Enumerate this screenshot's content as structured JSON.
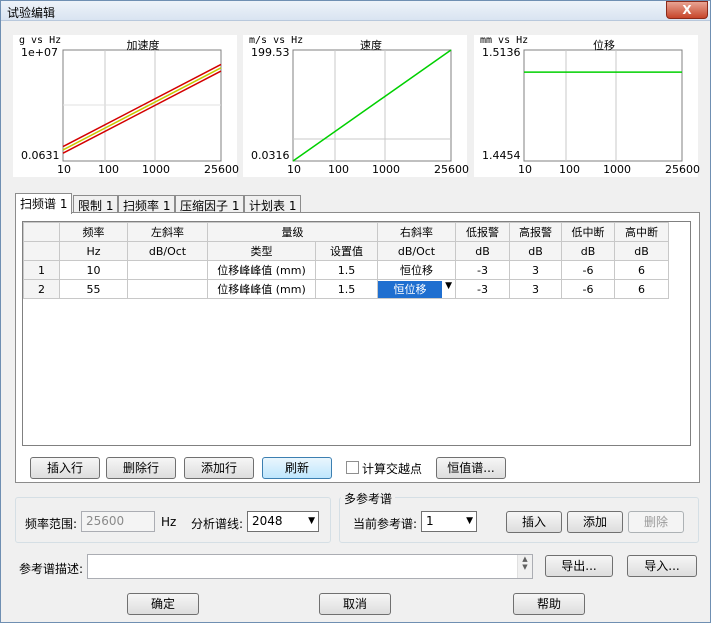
{
  "window": {
    "title": "试验编辑",
    "close_label": "X"
  },
  "charts": [
    {
      "title": "加速度",
      "unit": "g  vs  Hz",
      "y_top": "1e+07",
      "y_bottom": "0.0631",
      "x_ticks": [
        "10",
        "100",
        "1000",
        "25600"
      ]
    },
    {
      "title": "速度",
      "unit": "m/s  vs  Hz",
      "y_top": "199.53",
      "y_bottom": "0.0316",
      "x_ticks": [
        "10",
        "100",
        "1000",
        "25600"
      ]
    },
    {
      "title": "位移",
      "unit": "mm  vs  Hz",
      "y_top": "1.5136",
      "y_bottom": "1.4454",
      "x_ticks": [
        "10",
        "100",
        "1000",
        "25600"
      ]
    }
  ],
  "chart_data": [
    {
      "type": "line",
      "title": "加速度",
      "xlabel": "Hz",
      "ylabel": "g",
      "x_scale": "log",
      "y_scale": "log",
      "xlim": [
        10,
        25600
      ],
      "ylim": [
        0.0631,
        10000000
      ],
      "grid": true,
      "series": [
        {
          "color": "#d40000",
          "x": [
            10,
            25600
          ],
          "y_frac": [
            0.13,
            0.87
          ]
        },
        {
          "color": "#c8c800",
          "x": [
            10,
            25600
          ],
          "y_frac": [
            0.1,
            0.84
          ]
        },
        {
          "color": "#d40000",
          "x": [
            10,
            25600
          ],
          "y_frac": [
            0.07,
            0.81
          ]
        }
      ]
    },
    {
      "type": "line",
      "title": "速度",
      "xlabel": "Hz",
      "ylabel": "m/s",
      "x_scale": "log",
      "y_scale": "log",
      "xlim": [
        10,
        25600
      ],
      "ylim": [
        0.0316,
        199.53
      ],
      "grid": true,
      "series": [
        {
          "color": "#00d000",
          "x": [
            10,
            25600
          ],
          "y": [
            0.0316,
            199.53
          ]
        }
      ]
    },
    {
      "type": "line",
      "title": "位移",
      "xlabel": "Hz",
      "ylabel": "mm",
      "x_scale": "log",
      "xlim": [
        10,
        25600
      ],
      "ylim": [
        1.4454,
        1.5136
      ],
      "grid": true,
      "series": [
        {
          "color": "#00d000",
          "x": [
            10,
            25600
          ],
          "y": [
            1.5,
            1.5
          ]
        }
      ]
    }
  ],
  "tabs": [
    "扫频谱 1",
    "限制 1",
    "扫频率 1",
    "压缩因子 1",
    "计划表 1"
  ],
  "table": {
    "header1": [
      "频率",
      "左斜率",
      "量级",
      "右斜率",
      "低报警",
      "高报警",
      "低中断",
      "高中断"
    ],
    "header2": [
      "Hz",
      "dB/Oct",
      "类型",
      "设置值",
      "dB/Oct",
      "dB",
      "dB",
      "dB",
      "dB"
    ],
    "rows": [
      {
        "num": "1",
        "freq": "10",
        "left_slope": "",
        "type": "位移峰峰值 (mm)",
        "value": "1.5",
        "right_slope": "恒位移",
        "low_alarm": "-3",
        "high_alarm": "3",
        "low_abort": "-6",
        "high_abort": "6"
      },
      {
        "num": "2",
        "freq": "55",
        "left_slope": "",
        "type": "位移峰峰值 (mm)",
        "value": "1.5",
        "right_slope": "恒位移",
        "low_alarm": "-3",
        "high_alarm": "3",
        "low_abort": "-6",
        "high_abort": "6"
      }
    ]
  },
  "buttons": {
    "insert_row": "插入行",
    "delete_row": "删除行",
    "add_row": "添加行",
    "refresh": "刷新",
    "calc_cross": "计算交越点",
    "const_spectrum": "恒值谱..."
  },
  "freq_range": {
    "label": "频率范围:",
    "value": "25600",
    "unit": "Hz"
  },
  "analysis_lines": {
    "label": "分析谱线:",
    "value": "2048"
  },
  "multi_ref": {
    "title": "多参考谱",
    "current_label": "当前参考谱:",
    "current_value": "1",
    "insert": "插入",
    "add": "添加",
    "delete": "删除"
  },
  "ref_desc": {
    "label": "参考谱描述:",
    "value": "",
    "export": "导出...",
    "import": "导入..."
  },
  "footer": {
    "ok": "确定",
    "cancel": "取消",
    "help": "帮助"
  }
}
